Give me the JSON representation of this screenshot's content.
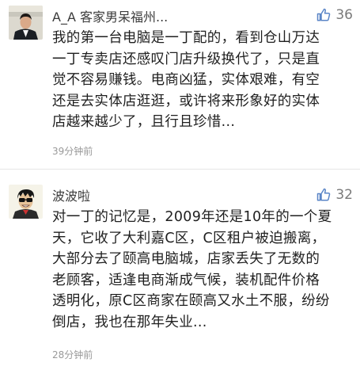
{
  "colors": {
    "username": "#3b3b3b",
    "text": "#1f1f1f",
    "meta": "#999999",
    "like_icon": "#5b86c7"
  },
  "comments": [
    {
      "username": "A_A 客家男呆福州...",
      "likes": "36",
      "like_icon": "thumbs-up-icon",
      "lines": [
        "我的第一台电脑是一丁配的，看到仓山万达",
        "一丁专卖店还感叹门店升级换代了，只是直",
        "觉不容易赚钱。电商凶猛，实体艰难，有空",
        "还是去实体店逛逛，或许将来形象好的实体",
        "店越来越少了，且行且珍惜..."
      ],
      "time": "39分钟前"
    },
    {
      "username": "波波啦",
      "likes": "32",
      "like_icon": "thumbs-up-icon",
      "lines": [
        "对一丁的记忆是，2009年还是10年的一个夏",
        "天，它收了大利嘉C区，C区租户被迫搬离，",
        "大部分去了颐高电脑城，店家丢失了无数的",
        "老顾客，适逢电商渐成气候，装机配件价格",
        "透明化，原C区商家在颐高又水土不服，纷纷",
        "倒店，我也在那年失业..."
      ],
      "time": "28分钟前"
    }
  ]
}
